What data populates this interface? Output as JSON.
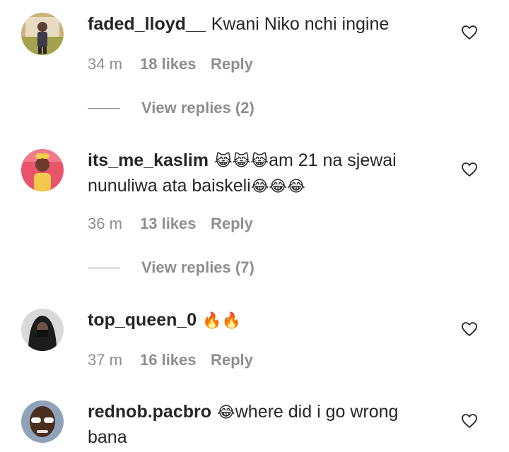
{
  "comments": [
    {
      "username": "faded_lloyd__",
      "text": "Kwani Niko nchi ingine",
      "emoji": "",
      "time": "34 m",
      "likes": "18 likes",
      "reply_label": "Reply",
      "view_replies": "View replies (2)"
    },
    {
      "username": "its_me_kaslim",
      "emoji_lead": "😹😹😹",
      "text": "am 21 na sjewai nunuliwa ata baiskeli",
      "emoji": "😂😂😂",
      "time": "36 m",
      "likes": "13 likes",
      "reply_label": "Reply",
      "view_replies": "View replies (7)"
    },
    {
      "username": "top_queen_0",
      "text": "",
      "emoji": "🔥🔥",
      "time": "37 m",
      "likes": "16 likes",
      "reply_label": "Reply"
    },
    {
      "username": "rednob.pacbro",
      "emoji_lead": "😂",
      "text": "where did i go wrong bana"
    }
  ],
  "colors": {
    "text": "#262626",
    "secondary": "#8e8e8e"
  },
  "icons": {
    "like": "heart-outline-icon"
  }
}
